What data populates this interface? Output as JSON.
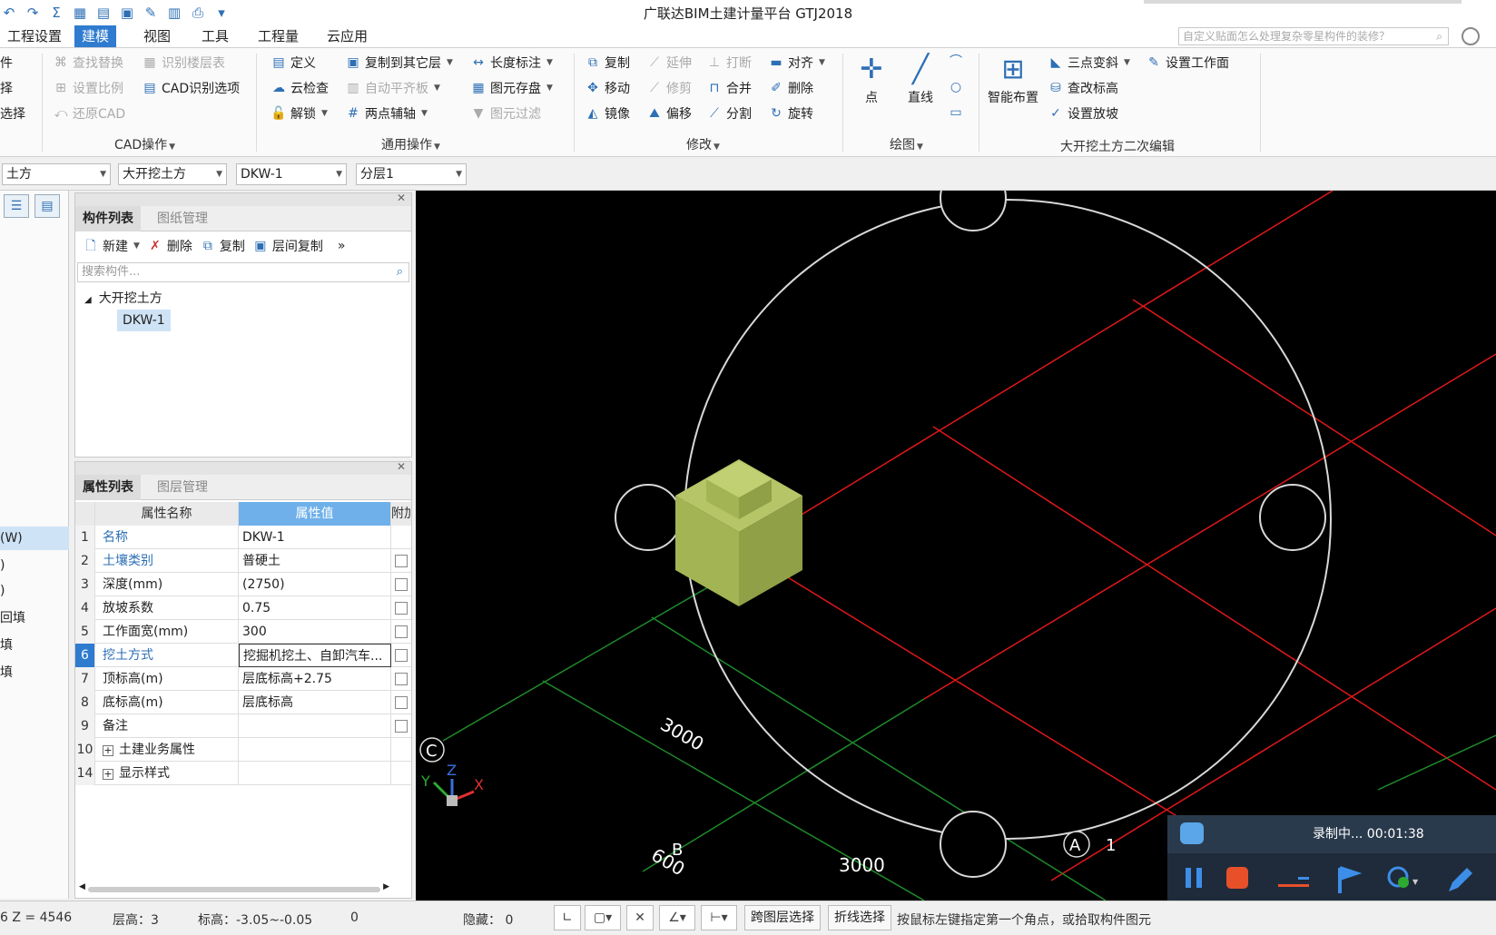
{
  "app": {
    "title": "广联达BIM土建计量平台 GTJ2018"
  },
  "menu": {
    "tabs": [
      "工程设置",
      "建模",
      "视图",
      "工具",
      "工程量",
      "云应用"
    ],
    "active": "建模",
    "help_placeholder": "自定义贴面怎么处理复杂零星构件的装修？"
  },
  "ribbon": {
    "left_cut": [
      "件",
      "择",
      "选择"
    ],
    "cad": {
      "items": [
        "查找替换",
        "识别楼层表",
        "设置比例",
        "CAD识别选项",
        "还原CAD"
      ],
      "label": "CAD操作"
    },
    "general": {
      "items": [
        "定义",
        "复制到其它层",
        "长度标注",
        "云检查",
        "自动平齐板",
        "图元存盘",
        "解锁",
        "两点辅轴",
        "图元过滤"
      ],
      "label": "通用操作"
    },
    "modify": {
      "items": [
        "复制",
        "延伸",
        "打断",
        "对齐",
        "移动",
        "修剪",
        "合并",
        "删除",
        "镜像",
        "偏移",
        "分割",
        "旋转"
      ],
      "label": "修改"
    },
    "draw": {
      "items": [
        "点",
        "直线"
      ],
      "label": "绘图"
    },
    "excavation": {
      "items": [
        "智能布置",
        "三点变斜",
        "设置工作面",
        "查改标高",
        "设置放坡"
      ],
      "label": "大开挖土方二次编辑"
    }
  },
  "selectors": [
    "土方",
    "大开挖土方",
    "DKW-1",
    "分层1"
  ],
  "leftnav": {
    "items": [
      "(W)",
      ")",
      ")",
      "回填",
      "填",
      "填"
    ]
  },
  "component_panel": {
    "tabs": [
      "构件列表",
      "图纸管理"
    ],
    "tools": [
      "新建",
      "删除",
      "复制",
      "层间复制"
    ],
    "search_placeholder": "搜索构件...",
    "tree_root": "大开挖土方",
    "tree_child": "DKW-1"
  },
  "property_panel": {
    "tabs": [
      "属性列表",
      "图层管理"
    ],
    "headers": [
      "属性名称",
      "属性值",
      "附加"
    ],
    "rows": [
      {
        "idx": "1",
        "name": "名称",
        "value": "DKW-1",
        "link": true,
        "check": false
      },
      {
        "idx": "2",
        "name": "土壤类别",
        "value": "普硬土",
        "link": true,
        "check": true
      },
      {
        "idx": "3",
        "name": "深度(mm)",
        "value": "(2750)",
        "link": false,
        "check": true
      },
      {
        "idx": "4",
        "name": "放坡系数",
        "value": "0.75",
        "link": false,
        "check": true
      },
      {
        "idx": "5",
        "name": "工作面宽(mm)",
        "value": "300",
        "link": false,
        "check": true
      },
      {
        "idx": "6",
        "name": "挖土方式",
        "value": "挖掘机挖土、自卸汽车...",
        "link": true,
        "check": true
      },
      {
        "idx": "7",
        "name": "顶标高(m)",
        "value": "层底标高+2.75",
        "link": false,
        "check": true
      },
      {
        "idx": "8",
        "name": "底标高(m)",
        "value": "层底标高",
        "link": false,
        "check": true
      },
      {
        "idx": "9",
        "name": "备注",
        "value": "",
        "link": false,
        "check": true
      },
      {
        "idx": "10",
        "name": "土建业务属性",
        "value": "",
        "link": false,
        "check": false,
        "expand": true
      },
      {
        "idx": "14",
        "name": "显示样式",
        "value": "",
        "link": false,
        "check": false,
        "expand": true
      }
    ]
  },
  "viewport": {
    "dim_labels": [
      "3000",
      "600",
      "3000"
    ],
    "axis_labels": [
      "C",
      "B",
      "A",
      "1"
    ],
    "triad": [
      "Y",
      "Z",
      "X"
    ],
    "colors": {
      "grid_red": "#e01818",
      "grid_green": "#1e8a2a",
      "circle": "#d8d8d8",
      "box": "#a3b454"
    }
  },
  "recording": {
    "status": "录制中... 00:01:38"
  },
  "status": {
    "z": "6 Z = 4546",
    "floor_height": "层高：3",
    "elevation": "标高：-3.05~-0.05",
    "zero": "0",
    "hidden": "隐藏：",
    "hidden_count": "0",
    "cross_layer": "跨图层选择",
    "polyline": "折线选择",
    "hint": "按鼠标左键指定第一个角点，或拾取构件图元"
  }
}
